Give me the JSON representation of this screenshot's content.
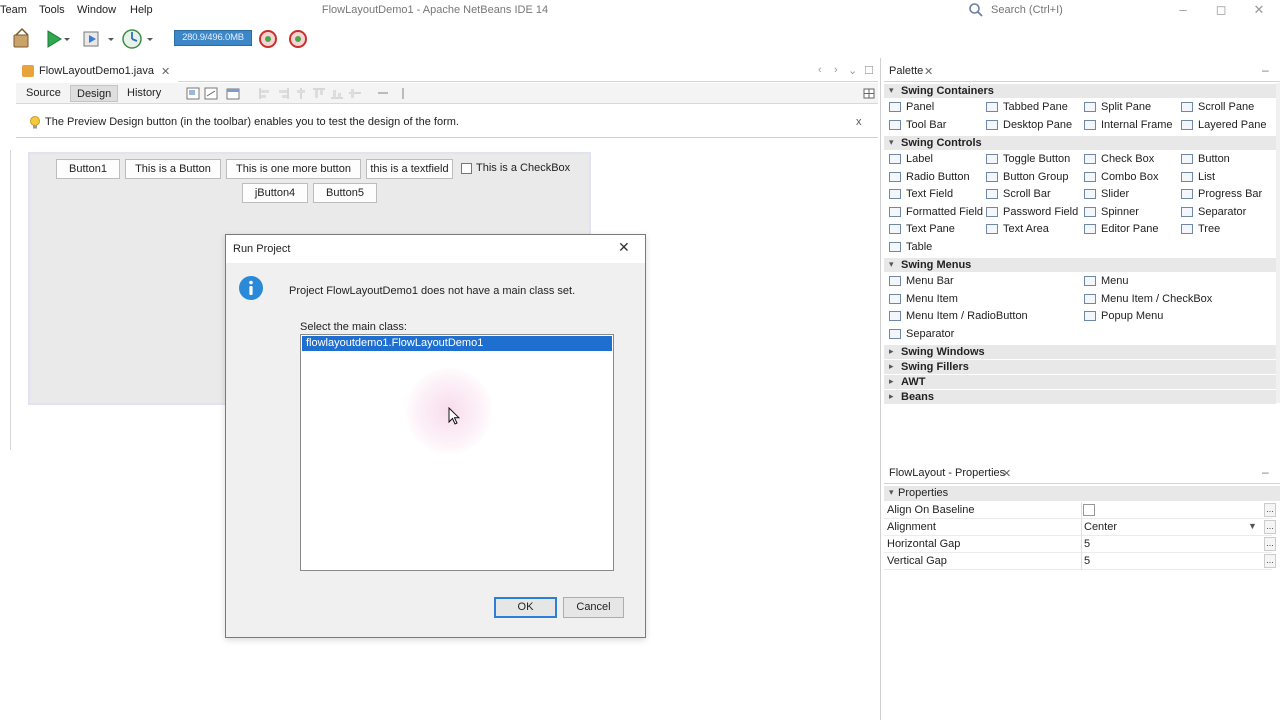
{
  "app": {
    "window_title": "FlowLayoutDemo1 - Apache NetBeans IDE 14",
    "menu": [
      "Team",
      "Tools",
      "Window",
      "Help"
    ],
    "search_placeholder": "Search (Ctrl+I)",
    "memory": "280.9/496.0MB"
  },
  "editor": {
    "file_tab": "FlowLayoutDemo1.java",
    "close_glyph": "✕",
    "views": [
      "Source",
      "Design",
      "History"
    ],
    "active_view": "Design",
    "hint": "The Preview Design button (in the toolbar) enables you to test the design of the form.",
    "hint_close": "x"
  },
  "form": {
    "buttons_row1": [
      "Button1",
      "This is a Button",
      "This is one more button"
    ],
    "textfield": "this is a textfield",
    "checkbox": "This is a CheckBox",
    "buttons_row2": [
      "jButton4",
      "Button5"
    ]
  },
  "dialog": {
    "title": "Run Project",
    "close_glyph": "✕",
    "message": "Project FlowLayoutDemo1 does not have a main class set.",
    "select_label": "Select the main class:",
    "items": [
      "flowlayoutdemo1.FlowLayoutDemo1"
    ],
    "ok": "OK",
    "cancel": "Cancel"
  },
  "palette": {
    "title": "Palette",
    "categories": [
      {
        "name": "Swing Containers",
        "expanded": true,
        "items": [
          "Panel",
          "Tabbed Pane",
          "Split Pane",
          "Scroll Pane",
          "Tool Bar",
          "Desktop Pane",
          "Internal Frame",
          "Layered Pane"
        ]
      },
      {
        "name": "Swing Controls",
        "expanded": true,
        "items": [
          "Label",
          "Toggle Button",
          "Check Box",
          "Button",
          "Radio Button",
          "Button Group",
          "Combo Box",
          "List",
          "Text Field",
          "Scroll Bar",
          "Slider",
          "Progress Bar",
          "Formatted Field",
          "Password Field",
          "Spinner",
          "Separator",
          "Text Pane",
          "Text Area",
          "Editor Pane",
          "Tree",
          "Table"
        ]
      },
      {
        "name": "Swing Menus",
        "expanded": true,
        "items": [
          "Menu Bar",
          "Menu",
          "Menu Item",
          "Menu Item / CheckBox",
          "Menu Item / RadioButton",
          "Popup Menu",
          "Separator"
        ]
      },
      {
        "name": "Swing Windows",
        "expanded": false,
        "items": []
      },
      {
        "name": "Swing Fillers",
        "expanded": false,
        "items": []
      },
      {
        "name": "AWT",
        "expanded": false,
        "items": []
      },
      {
        "name": "Beans",
        "expanded": false,
        "items": []
      }
    ]
  },
  "properties": {
    "title": "FlowLayout - Properties",
    "section": "Properties",
    "rows": [
      {
        "name": "Align On Baseline",
        "value": ""
      },
      {
        "name": "Alignment",
        "value": "Center"
      },
      {
        "name": "Horizontal Gap",
        "value": "5"
      },
      {
        "name": "Vertical Gap",
        "value": "5"
      }
    ]
  }
}
